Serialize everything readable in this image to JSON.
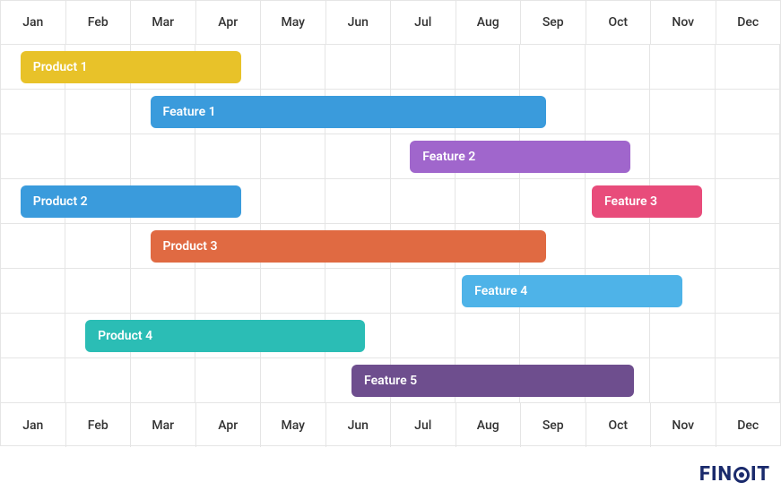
{
  "chart_data": {
    "type": "gantt",
    "months": [
      "Jan",
      "Feb",
      "Mar",
      "Apr",
      "May",
      "Jun",
      "Jul",
      "Aug",
      "Sep",
      "Oct",
      "Nov",
      "Dec"
    ],
    "tasks": [
      {
        "label": "Product 1",
        "start": 0.3,
        "end": 3.7,
        "color": "#e8c229"
      },
      {
        "label": "Feature 1",
        "start": 2.3,
        "end": 8.4,
        "color": "#3a9bdc"
      },
      {
        "label": "Feature 2",
        "start": 6.3,
        "end": 9.7,
        "color": "#a066cc"
      },
      {
        "label": "Product 2",
        "start": 0.3,
        "end": 3.7,
        "color": "#3a9bdc",
        "siblings": [
          {
            "label": "Feature 3",
            "start": 9.1,
            "end": 10.8,
            "color": "#e84c7b"
          }
        ]
      },
      {
        "label": "Product 3",
        "start": 2.3,
        "end": 8.4,
        "color": "#e06a42"
      },
      {
        "label": "Feature 4",
        "start": 7.1,
        "end": 10.5,
        "color": "#4eb3e8"
      },
      {
        "label": "Product 4",
        "start": 1.3,
        "end": 5.6,
        "color": "#2bbdb5"
      },
      {
        "label": "Feature 5",
        "start": 5.4,
        "end": 9.75,
        "color": "#6e4e8e"
      }
    ]
  },
  "brand": {
    "name": "FINOIT",
    "pre": "FIN",
    "post": "IT"
  }
}
